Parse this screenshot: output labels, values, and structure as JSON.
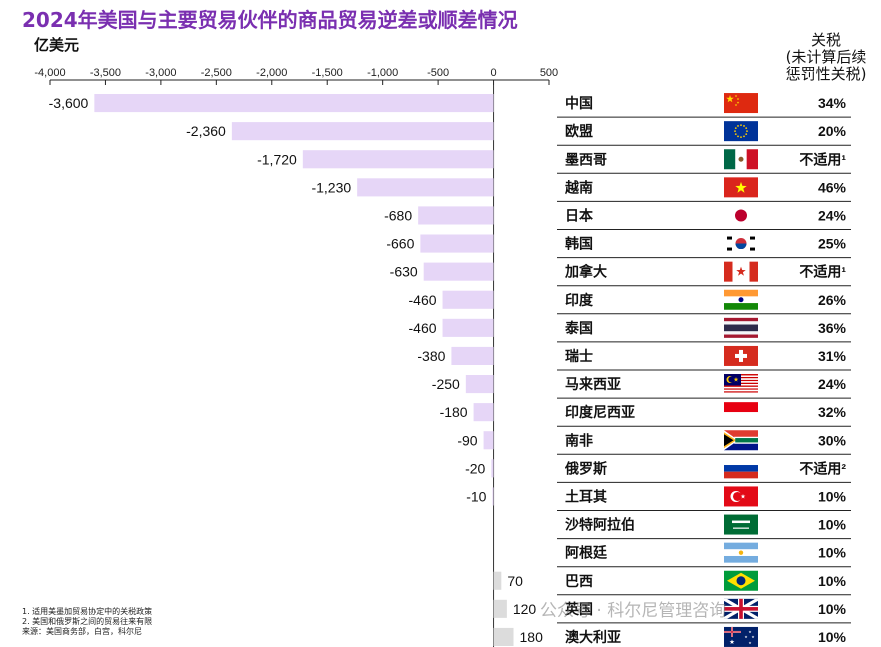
{
  "title": "2024年美国与主要贸易伙伴的商品贸易逆差或顺差情况",
  "unit_label": "亿美元",
  "tariff_header": [
    "关税",
    "(未计算后续",
    "惩罚性关税)"
  ],
  "footnotes": [
    "1. 适用美墨加贸易协定中的关税政策",
    "2. 美国和俄罗斯之间的贸易往来有限",
    "来源：美国商务部，白宫，科尔尼"
  ],
  "watermark": "公众号 · 科尔尼管理咨询",
  "colors": {
    "bar": "#e6d6f7",
    "title": "#7a2fb0",
    "axis": "#222222"
  },
  "chart_data": {
    "type": "bar",
    "orientation": "horizontal",
    "title": "2024年美国与主要贸易伙伴的商品贸易逆差或顺差情况",
    "xlabel": "亿美元",
    "xlim": [
      -4000,
      500
    ],
    "xticks": [
      "-4,000",
      "-3,500",
      "-3,000",
      "-2,500",
      "-2,000",
      "-1,500",
      "-1,000",
      "-500",
      "0",
      "500"
    ],
    "grid": false,
    "categories": [
      "中国",
      "欧盟",
      "墨西哥",
      "越南",
      "日本",
      "韩国",
      "加拿大",
      "印度",
      "泰国",
      "瑞士",
      "马来西亚",
      "印度尼西亚",
      "南非",
      "俄罗斯",
      "土耳其",
      "沙特阿拉伯",
      "阿根廷",
      "巴西",
      "英国",
      "澳大利亚"
    ],
    "values": [
      -3600,
      -2360,
      -1720,
      -1230,
      -680,
      -660,
      -630,
      -460,
      -460,
      -380,
      -250,
      -180,
      -90,
      -20,
      -10,
      0,
      0,
      70,
      120,
      180
    ],
    "value_labels": [
      "-3,600",
      "-2,360",
      "-1,720",
      "-1,230",
      "-680",
      "-660",
      "-630",
      "-460",
      "-460",
      "-380",
      "-250",
      "-180",
      "-90",
      "-20",
      "-10",
      "",
      "",
      "70",
      "120",
      "180"
    ],
    "tariffs": [
      "34%",
      "20%",
      "不适用¹",
      "46%",
      "24%",
      "25%",
      "不适用¹",
      "26%",
      "36%",
      "31%",
      "24%",
      "32%",
      "30%",
      "不适用²",
      "10%",
      "10%",
      "10%",
      "10%",
      "10%",
      "10%"
    ],
    "flags": [
      "china-flag",
      "eu-flag",
      "mexico-flag",
      "vietnam-flag",
      "japan-flag",
      "korea-flag",
      "canada-flag",
      "india-flag",
      "thailand-flag",
      "switzerland-flag",
      "malaysia-flag",
      "indonesia-flag",
      "south-africa-flag",
      "russia-flag",
      "turkey-flag",
      "saudi-arabia-flag",
      "argentina-flag",
      "brazil-flag",
      "uk-flag",
      "australia-flag"
    ]
  }
}
